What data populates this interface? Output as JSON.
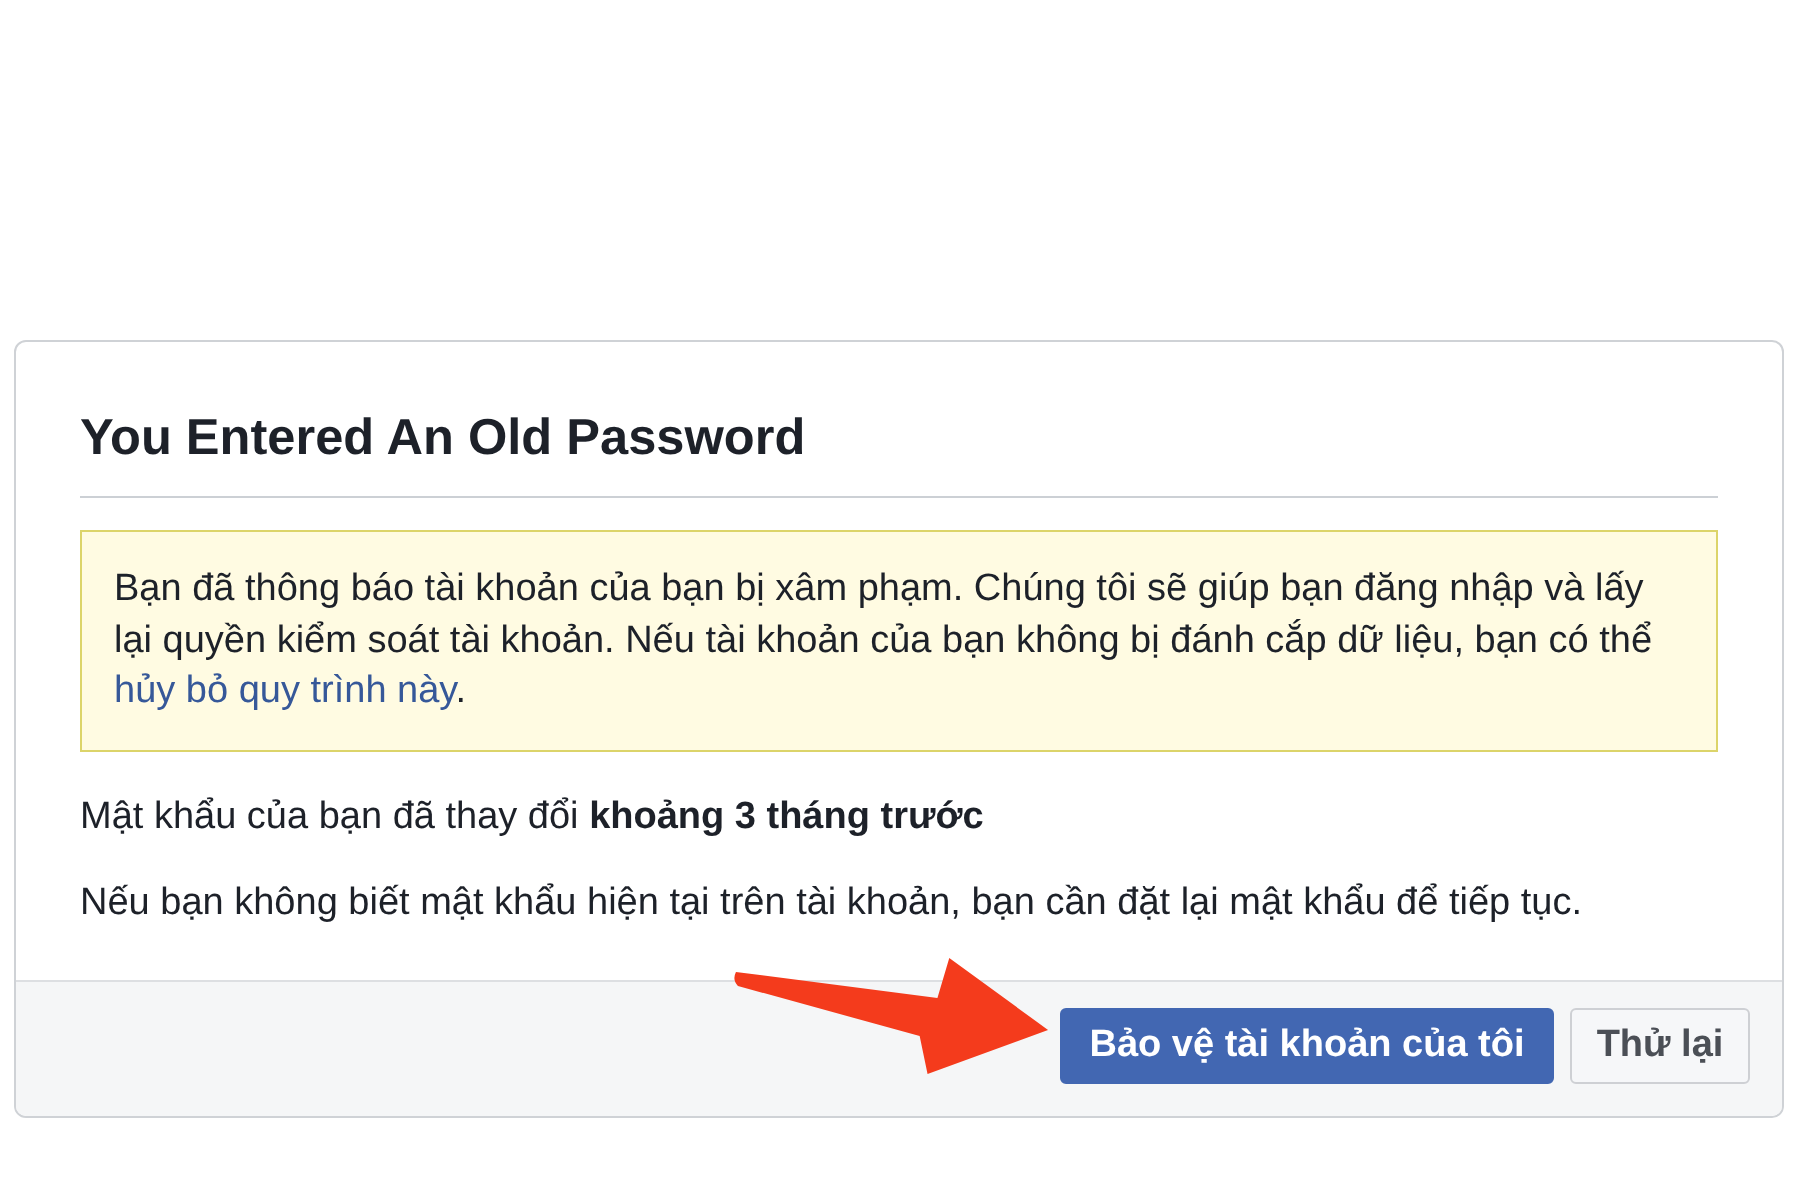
{
  "dialog": {
    "title": "You Entered An Old Password",
    "notice": {
      "text": "Bạn đã thông báo tài khoản của bạn bị xâm phạm. Chúng tôi sẽ giúp bạn đăng nhập và lấy lại quyền kiểm soát tài khoản. Nếu tài khoản của bạn không bị đánh cắp dữ liệu, bạn có thể",
      "link": "hủy bỏ quy trình này",
      "after_link": "."
    },
    "paragraphs": [
      "Mật khẩu của bạn đã thay đổi **khoảng 3 tháng trước**",
      "Nếu bạn không biết mật khẩu hiện tại trên tài khoản, bạn cần đặt lại mật khẩu để tiếp tục."
    ],
    "buttons": [
      {
        "label": "Bảo vệ tài khoản của tôi",
        "kind": "primary"
      },
      {
        "label": "Thử lại",
        "kind": "secondary"
      }
    ]
  }
}
